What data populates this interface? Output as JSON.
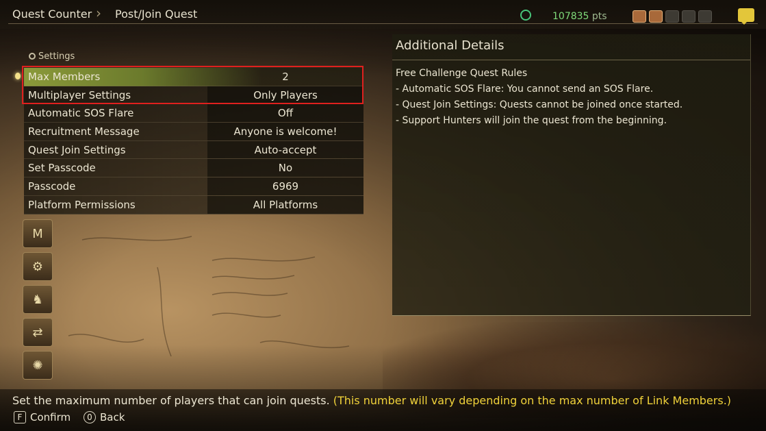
{
  "header": {
    "breadcrumb": [
      "Quest Counter",
      "Post/Join Quest"
    ],
    "points_value": "107835",
    "points_unit": "pts",
    "member_slots": [
      {
        "state": "filled"
      },
      {
        "state": "filled"
      },
      {
        "state": "empty"
      },
      {
        "state": "empty"
      },
      {
        "state": "empty"
      }
    ]
  },
  "settings": {
    "section_label": "Settings",
    "selected_index": 0,
    "rows": [
      {
        "label": "Max Members",
        "value": "2"
      },
      {
        "label": "Multiplayer Settings",
        "value": "Only Players"
      },
      {
        "label": "Automatic SOS Flare",
        "value": "Off"
      },
      {
        "label": "Recruitment Message",
        "value": "Anyone is welcome!"
      },
      {
        "label": "Quest Join Settings",
        "value": "Auto-accept"
      },
      {
        "label": "Set Passcode",
        "value": "No"
      },
      {
        "label": "Passcode",
        "value": "6969"
      },
      {
        "label": "Platform Permissions",
        "value": "All Platforms"
      }
    ]
  },
  "side_icons": [
    "menu-icon",
    "gear-settings-icon",
    "hunter-icon",
    "transfer-icon",
    "light-icon"
  ],
  "details": {
    "title": "Additional Details",
    "lines": [
      "Free Challenge Quest Rules",
      "- Automatic SOS Flare: You cannot send an SOS Flare.",
      "- Quest Join Settings: Quests cannot be joined once started.",
      "- Support Hunters will join the quest from the beginning."
    ]
  },
  "footer": {
    "help": "Set the maximum number of players that can join quests.",
    "help_note": "(This number will vary depending on the max number of Link Members.)",
    "confirm_key": "F",
    "confirm_label": "Confirm",
    "back_key": "0",
    "back_label": "Back"
  },
  "colors": {
    "highlight_border": "#e0201e",
    "points_text": "#7fdc7a",
    "note_text": "#f0d23a"
  }
}
